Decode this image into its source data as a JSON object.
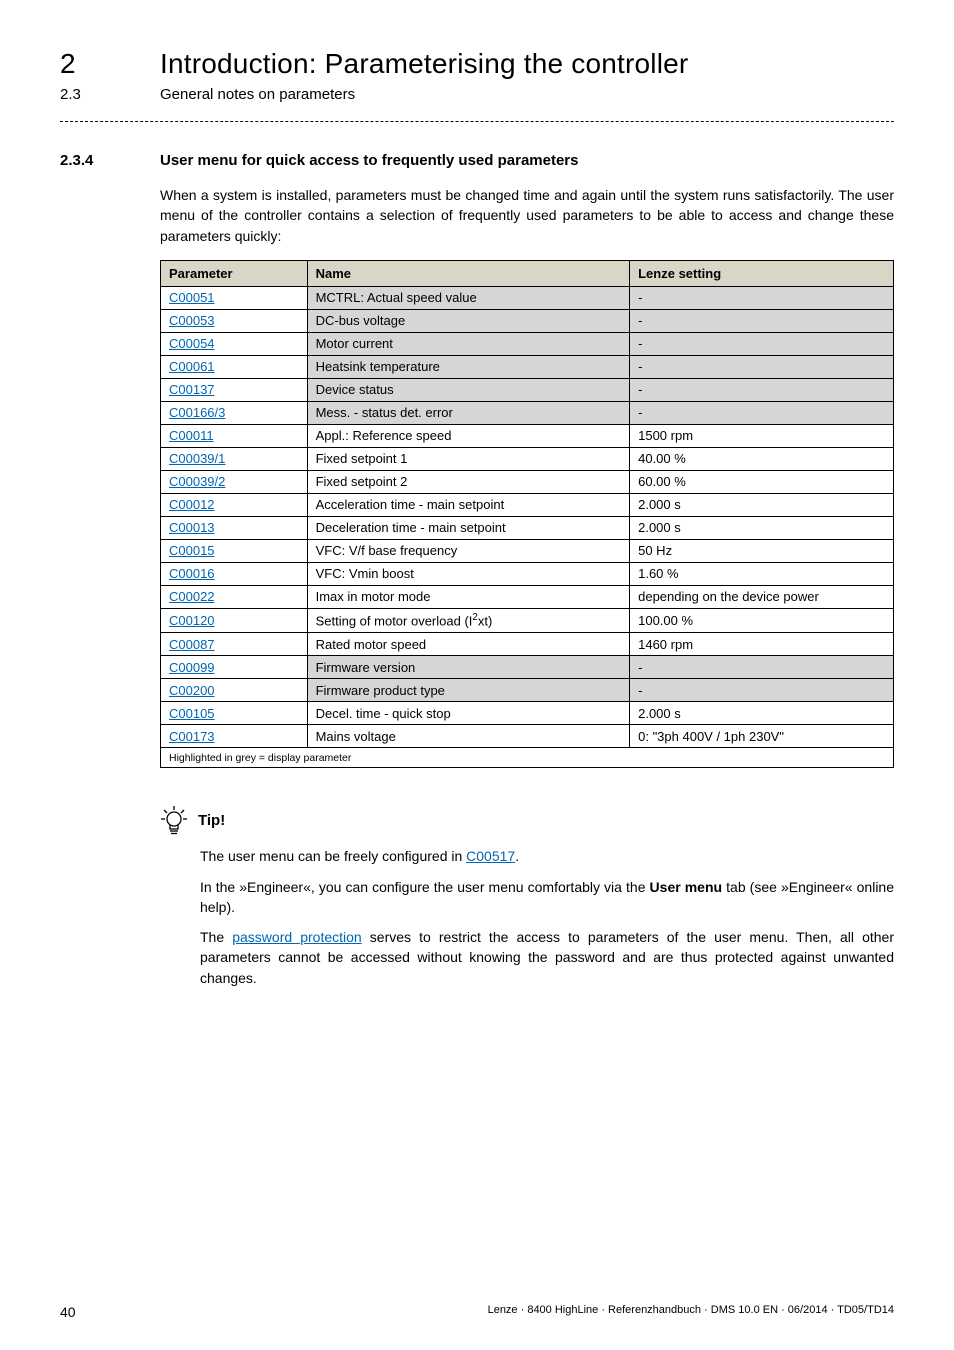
{
  "header": {
    "chapter_num": "2",
    "chapter_title": "Introduction: Parameterising the controller",
    "subchapter_num": "2.3",
    "subchapter_title": "General notes on parameters"
  },
  "section": {
    "num": "2.3.4",
    "title": "User menu for quick access to frequently used parameters",
    "intro": "When a system is installed, parameters must be changed time and again until the system runs satisfactorily. The user menu of the controller contains a selection of frequently used parameters to be able to access and change these parameters quickly:"
  },
  "table": {
    "headers": {
      "c0": "Parameter",
      "c1": "Name",
      "c2": "Lenze setting"
    },
    "rows": [
      {
        "param": "C00051",
        "name": "MCTRL: Actual speed value",
        "setting": "-",
        "grey": true
      },
      {
        "param": "C00053",
        "name": "DC-bus voltage",
        "setting": "-",
        "grey": true
      },
      {
        "param": "C00054",
        "name": "Motor current",
        "setting": "-",
        "grey": true
      },
      {
        "param": "C00061",
        "name": "Heatsink temperature",
        "setting": "-",
        "grey": true
      },
      {
        "param": "C00137",
        "name": "Device status",
        "setting": "-",
        "grey": true
      },
      {
        "param": "C00166/3",
        "name": "Mess. - status det. error",
        "setting": "-",
        "grey": true
      },
      {
        "param": "C00011",
        "name": "Appl.: Reference speed",
        "setting": "1500 rpm",
        "grey": false
      },
      {
        "param": "C00039/1",
        "name": "Fixed setpoint 1",
        "setting": "40.00 %",
        "grey": false
      },
      {
        "param": "C00039/2",
        "name": "Fixed setpoint 2",
        "setting": "60.00 %",
        "grey": false
      },
      {
        "param": "C00012",
        "name": "Acceleration time - main setpoint",
        "setting": "2.000 s",
        "grey": false
      },
      {
        "param": "C00013",
        "name": "Deceleration time - main setpoint",
        "setting": "2.000 s",
        "grey": false
      },
      {
        "param": "C00015",
        "name": "VFC: V/f base frequency",
        "setting": "50 Hz",
        "grey": false
      },
      {
        "param": "C00016",
        "name": "VFC: Vmin boost",
        "setting": "1.60 %",
        "grey": false
      },
      {
        "param": "C00022",
        "name": "Imax in motor mode",
        "setting": "depending on the device power",
        "grey": false
      },
      {
        "param": "C00120",
        "name": "Setting of motor overload (I²xt)",
        "setting": "100.00 %",
        "grey": false,
        "sup": true
      },
      {
        "param": "C00087",
        "name": "Rated motor speed",
        "setting": "1460 rpm",
        "grey": false
      },
      {
        "param": "C00099",
        "name": "Firmware version",
        "setting": "-",
        "grey": true
      },
      {
        "param": "C00200",
        "name": "Firmware product type",
        "setting": "-",
        "grey": true
      },
      {
        "param": "C00105",
        "name": "Decel. time - quick stop",
        "setting": "2.000 s",
        "grey": false
      },
      {
        "param": "C00173",
        "name": "Mains voltage",
        "setting": "0: \"3ph 400V / 1ph 230V\"",
        "grey": false
      }
    ],
    "footnote": "Highlighted in grey = display parameter"
  },
  "tip": {
    "label": "Tip!",
    "line1_pre": "The user menu can be freely configured in ",
    "line1_link": "C00517",
    "line1_post": ".",
    "line2_pre": "In the »Engineer«, you can configure the user menu comfortably via the ",
    "line2_bold": "User menu",
    "line2_post": " tab (see »Engineer« online help).",
    "line3_pre": "The ",
    "line3_link": "password protection",
    "line3_post": " serves to restrict the access to parameters of the user menu. Then, all other parameters cannot be accessed without knowing the password and are thus protected against unwanted changes."
  },
  "footer": {
    "page": "40",
    "text": "Lenze · 8400 HighLine · Referenzhandbuch · DMS 10.0 EN · 06/2014 · TD05/TD14"
  }
}
